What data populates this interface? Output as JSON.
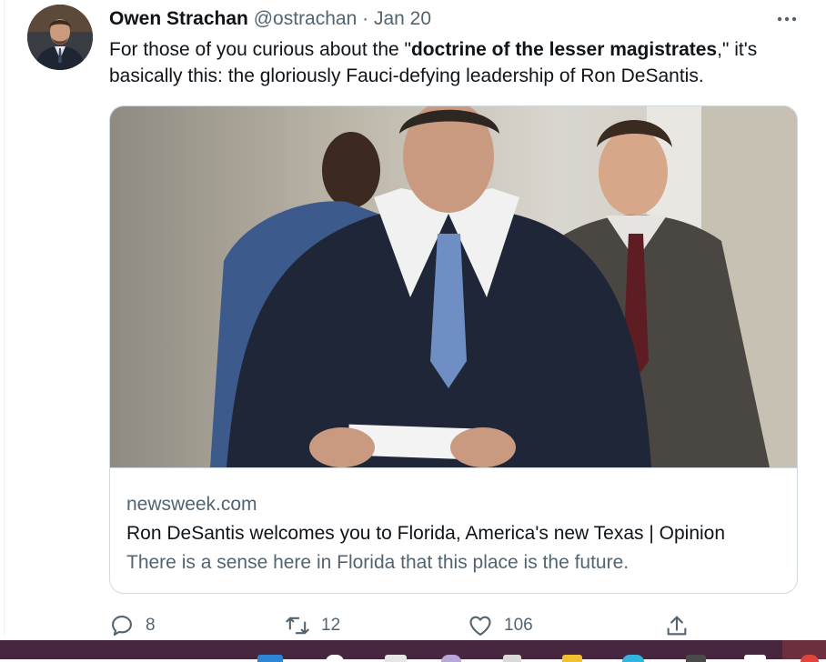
{
  "tweet": {
    "author_name": "Owen Strachan",
    "handle": "@ostrachan",
    "separator": " · ",
    "date": "Jan 20",
    "more_icon": "more-icon",
    "text_before": "For those of you curious about the \"",
    "text_bold": "doctrine of the lesser magistrates",
    "text_after": ",\" it's basically this: the gloriously Fauci-defying leadership of Ron DeSantis."
  },
  "link_card": {
    "domain": "newsweek.com",
    "title": "Ron DeSantis welcomes you to Florida, America's new Texas | Opinion",
    "description": "There is a sense here in Florida that this place is the future."
  },
  "actions": {
    "reply_count": "8",
    "retweet_count": "12",
    "like_count": "106"
  },
  "colors": {
    "text_primary": "#0f1419",
    "text_muted": "#536471",
    "border": "#cfd9de",
    "taskbar": "#46253f"
  }
}
